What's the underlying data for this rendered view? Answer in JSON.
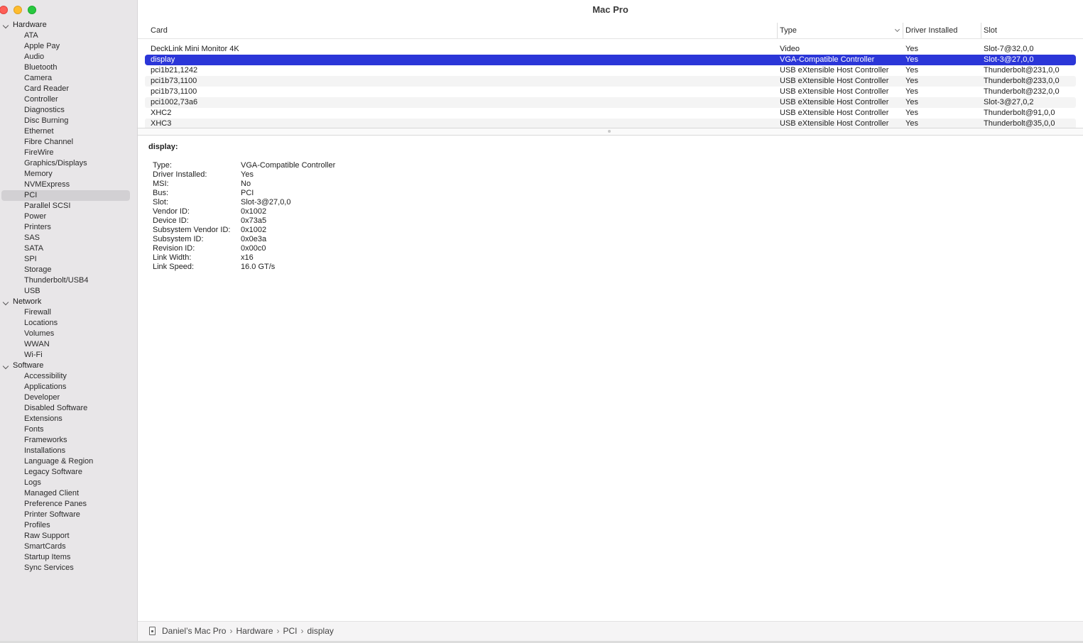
{
  "window": {
    "title": "Mac Pro"
  },
  "sidebar": {
    "groups": [
      {
        "label": "Hardware",
        "items": [
          "ATA",
          "Apple Pay",
          "Audio",
          "Bluetooth",
          "Camera",
          "Card Reader",
          "Controller",
          "Diagnostics",
          "Disc Burning",
          "Ethernet",
          "Fibre Channel",
          "FireWire",
          "Graphics/Displays",
          "Memory",
          "NVMExpress",
          "PCI",
          "Parallel SCSI",
          "Power",
          "Printers",
          "SAS",
          "SATA",
          "SPI",
          "Storage",
          "Thunderbolt/USB4",
          "USB"
        ]
      },
      {
        "label": "Network",
        "items": [
          "Firewall",
          "Locations",
          "Volumes",
          "WWAN",
          "Wi-Fi"
        ]
      },
      {
        "label": "Software",
        "items": [
          "Accessibility",
          "Applications",
          "Developer",
          "Disabled Software",
          "Extensions",
          "Fonts",
          "Frameworks",
          "Installations",
          "Language & Region",
          "Legacy Software",
          "Logs",
          "Managed Client",
          "Preference Panes",
          "Printer Software",
          "Profiles",
          "Raw Support",
          "SmartCards",
          "Startup Items",
          "Sync Services"
        ]
      }
    ],
    "selected": "PCI"
  },
  "table": {
    "columns": [
      {
        "label": "Card"
      },
      {
        "label": "Type",
        "sorted": true
      },
      {
        "label": "Driver Installed"
      },
      {
        "label": "Slot"
      }
    ],
    "rows": [
      {
        "card": "DeckLink Mini Monitor 4K",
        "type": "Video",
        "driver": "Yes",
        "slot": "Slot-7@32,0,0"
      },
      {
        "card": "display",
        "type": "VGA-Compatible Controller",
        "driver": "Yes",
        "slot": "Slot-3@27,0,0",
        "selected": true
      },
      {
        "card": "pci1b21,1242",
        "type": "USB eXtensible Host Controller",
        "driver": "Yes",
        "slot": "Thunderbolt@231,0,0"
      },
      {
        "card": "pci1b73,1100",
        "type": "USB eXtensible Host Controller",
        "driver": "Yes",
        "slot": "Thunderbolt@233,0,0"
      },
      {
        "card": "pci1b73,1100",
        "type": "USB eXtensible Host Controller",
        "driver": "Yes",
        "slot": "Thunderbolt@232,0,0"
      },
      {
        "card": "pci1002,73a6",
        "type": "USB eXtensible Host Controller",
        "driver": "Yes",
        "slot": "Slot-3@27,0,2"
      },
      {
        "card": "XHC2",
        "type": "USB eXtensible Host Controller",
        "driver": "Yes",
        "slot": "Thunderbolt@91,0,0"
      },
      {
        "card": "XHC3",
        "type": "USB eXtensible Host Controller",
        "driver": "Yes",
        "slot": "Thunderbolt@35,0,0"
      }
    ]
  },
  "detail": {
    "title": "display:",
    "properties": [
      {
        "key": "Type:",
        "value": "VGA-Compatible Controller"
      },
      {
        "key": "Driver Installed:",
        "value": "Yes"
      },
      {
        "key": "MSI:",
        "value": "No"
      },
      {
        "key": "Bus:",
        "value": "PCI"
      },
      {
        "key": "Slot:",
        "value": "Slot-3@27,0,0"
      },
      {
        "key": "Vendor ID:",
        "value": "0x1002"
      },
      {
        "key": "Device ID:",
        "value": "0x73a5"
      },
      {
        "key": "Subsystem Vendor ID:",
        "value": "0x1002"
      },
      {
        "key": "Subsystem ID:",
        "value": "0x0e3a"
      },
      {
        "key": "Revision ID:",
        "value": "0x00c0"
      },
      {
        "key": "Link Width:",
        "value": "x16"
      },
      {
        "key": "Link Speed:",
        "value": "16.0 GT/s"
      }
    ]
  },
  "pathbar": {
    "crumbs": [
      "Daniel’s Mac Pro",
      "Hardware",
      "PCI",
      "display"
    ],
    "separator": "›"
  },
  "colors": {
    "selection": "#2b36d8",
    "sidebar_bg": "#e8e6e8",
    "sidebar_selected": "#d2d0d3",
    "close": "#fe5f57",
    "minimize": "#febc2e",
    "maximize": "#28c840"
  },
  "icons": {
    "group_chevron": "chevron-down-icon",
    "sort_indicator": "chevron-down-icon",
    "computer": "computer-icon"
  }
}
